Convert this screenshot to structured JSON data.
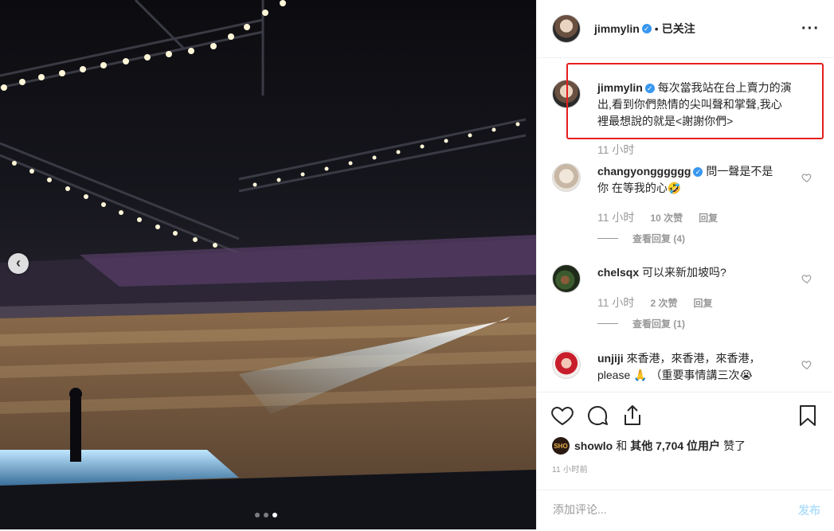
{
  "post": {
    "author": "jimmylin",
    "follow_state": "已关注",
    "dot": "•",
    "more_icon": "more-horizontal-icon",
    "carousel_total": 3,
    "carousel_active": 3
  },
  "comments": [
    {
      "username": "jimmylin",
      "verified": true,
      "text": "每次當我站在台上賣力的演出,看到你們熱情的尖叫聲和掌聲,我心裡最想說的就是<謝謝你們>",
      "time": "11 小时"
    },
    {
      "username": "changyongggggg",
      "verified": true,
      "text": "問一聲是不是你 在等我的心🤣",
      "time": "11 小时",
      "likes": "10 次赞",
      "reply": "回复",
      "view_replies": "查看回复 (4)"
    },
    {
      "username": "chelsqx",
      "verified": false,
      "text": "可以来新加坡吗?",
      "time": "11 小时",
      "likes": "2 次赞",
      "reply": "回复",
      "view_replies": "查看回复 (1)"
    },
    {
      "username": "unjiji",
      "verified": false,
      "text": "來香港，來香港，來香港，please 🙏 （重要事情講三次😭"
    }
  ],
  "likes_summary": {
    "avatar_text": "SHO",
    "user": "showlo",
    "and": "和",
    "others": "其他 7,704 位用户",
    "suffix": "赞了"
  },
  "post_time": "11 小时前",
  "add_comment": {
    "placeholder": "添加评论...",
    "post_label": "发布"
  },
  "colors": {
    "highlight_border": "#e61e1e",
    "verified": "#3897f0",
    "post_disabled": "#b2dffc"
  }
}
